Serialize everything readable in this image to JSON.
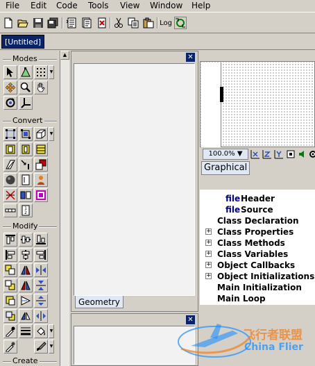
{
  "menu": {
    "file": "File",
    "edit": "Edit",
    "code": "Code",
    "tools": "Tools",
    "view": "View",
    "window": "Window",
    "help": "Help"
  },
  "toolbar": {
    "log_label": "Log"
  },
  "doc_tab": "[Untitled]",
  "palette": {
    "modes": "Modes",
    "convert": "Convert",
    "modify": "Modify",
    "create": "Create"
  },
  "geometry_tab": "Geometry",
  "graphical": {
    "zoom": "100.0%",
    "zoom_arrow": "▼",
    "tab": "Graphical"
  },
  "tree": {
    "items": [
      {
        "prefix": "file",
        "label": "Header",
        "expander": false
      },
      {
        "prefix": "file",
        "label": "Source",
        "expander": false
      },
      {
        "prefix": "",
        "label": "Class Declaration",
        "expander": false
      },
      {
        "prefix": "",
        "label": "Class Properties",
        "expander": true
      },
      {
        "prefix": "",
        "label": "Class Methods",
        "expander": true
      },
      {
        "prefix": "",
        "label": "Class Variables",
        "expander": true
      },
      {
        "prefix": "",
        "label": "Object Callbacks",
        "expander": true
      },
      {
        "prefix": "",
        "label": "Object Initializations",
        "expander": true
      },
      {
        "prefix": "",
        "label": "Main Initialization",
        "expander": false
      },
      {
        "prefix": "",
        "label": "Main Loop",
        "expander": false
      }
    ]
  },
  "watermark": {
    "cn": "飞行者联盟",
    "en": "China Flier"
  },
  "colors": {
    "accent": "#0a246a",
    "panel_bg": "#d4d0c8",
    "tree_file": "#00008b",
    "watermark_blue": "#1e90ff",
    "watermark_orange": "#f08020"
  }
}
